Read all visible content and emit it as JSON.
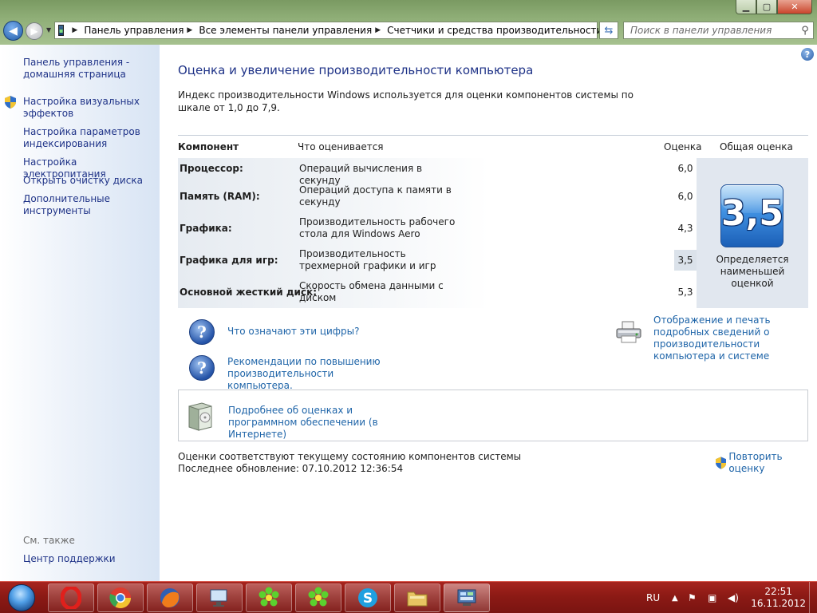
{
  "address": {
    "breadcrumbs": [
      "Панель управления",
      "Все элементы панели управления",
      "Счетчики и средства производительности"
    ]
  },
  "search": {
    "placeholder": "Поиск в панели управления"
  },
  "sidebar": {
    "items": [
      {
        "label": "Панель управления - домашняя страница",
        "shield": false
      },
      {
        "label": "Настройка визуальных эффектов",
        "shield": true
      },
      {
        "label": "Настройка параметров индексирования",
        "shield": false
      },
      {
        "label": "Настройка электропитания",
        "shield": false
      },
      {
        "label": "Открыть очистку диска",
        "shield": false
      },
      {
        "label": "Дополнительные инструменты",
        "shield": false
      }
    ],
    "see_also": "См. также",
    "support_link": "Центр поддержки"
  },
  "main": {
    "title": "Оценка и увеличение производительности компьютера",
    "intro": "Индекс производительности Windows используется для оценки компонентов системы по шкале от 1,0 до 7,9.",
    "table": {
      "headers": {
        "component": "Компонент",
        "rated": "Что оценивается",
        "score": "Оценка",
        "total": "Общая оценка"
      },
      "rows": [
        {
          "component": "Процессор:",
          "rated": "Операций вычисления в секунду",
          "score": "6,0"
        },
        {
          "component": "Память (RAM):",
          "rated": "Операций доступа к памяти в секунду",
          "score": "6,0"
        },
        {
          "component": "Графика:",
          "rated": "Производительность рабочего стола для Windows Aero",
          "score": "4,3"
        },
        {
          "component": "Графика для игр:",
          "rated": "Производительность трехмерной графики и игр",
          "score": "3,5"
        },
        {
          "component": "Основной жесткий диск:",
          "rated": "Скорость обмена данными с диском",
          "score": "5,3"
        }
      ],
      "base_score": "3,5",
      "base_score_caption": "Определяется наименьшей оценкой"
    },
    "links": {
      "what_numbers": "Что означают эти цифры?",
      "tips": "Рекомендации по повышению производительности компьютера.",
      "print_details": "Отображение и печать подробных сведений о производительности компьютера и системе",
      "learn_more": "Подробнее об оценках и программном обеспечении (в Интернете)"
    },
    "status": {
      "line1": "Оценки соответствуют текущему состоянию компонентов системы",
      "line2": "Последнее обновление: 07.10.2012 12:36:54",
      "rerun": "Повторить оценку"
    }
  },
  "taskbar": {
    "apps": [
      "opera",
      "chrome",
      "firefox",
      "remote-desktop",
      "icq",
      "icq",
      "skype",
      "explorer",
      "control-panel"
    ],
    "language": "RU",
    "time": "22:51",
    "date": "16.11.2012"
  },
  "colors": {
    "accent": "#1e3287",
    "link": "#1e64a8",
    "taskbar": "#8c1a15",
    "badge": "#3f8fe0"
  }
}
